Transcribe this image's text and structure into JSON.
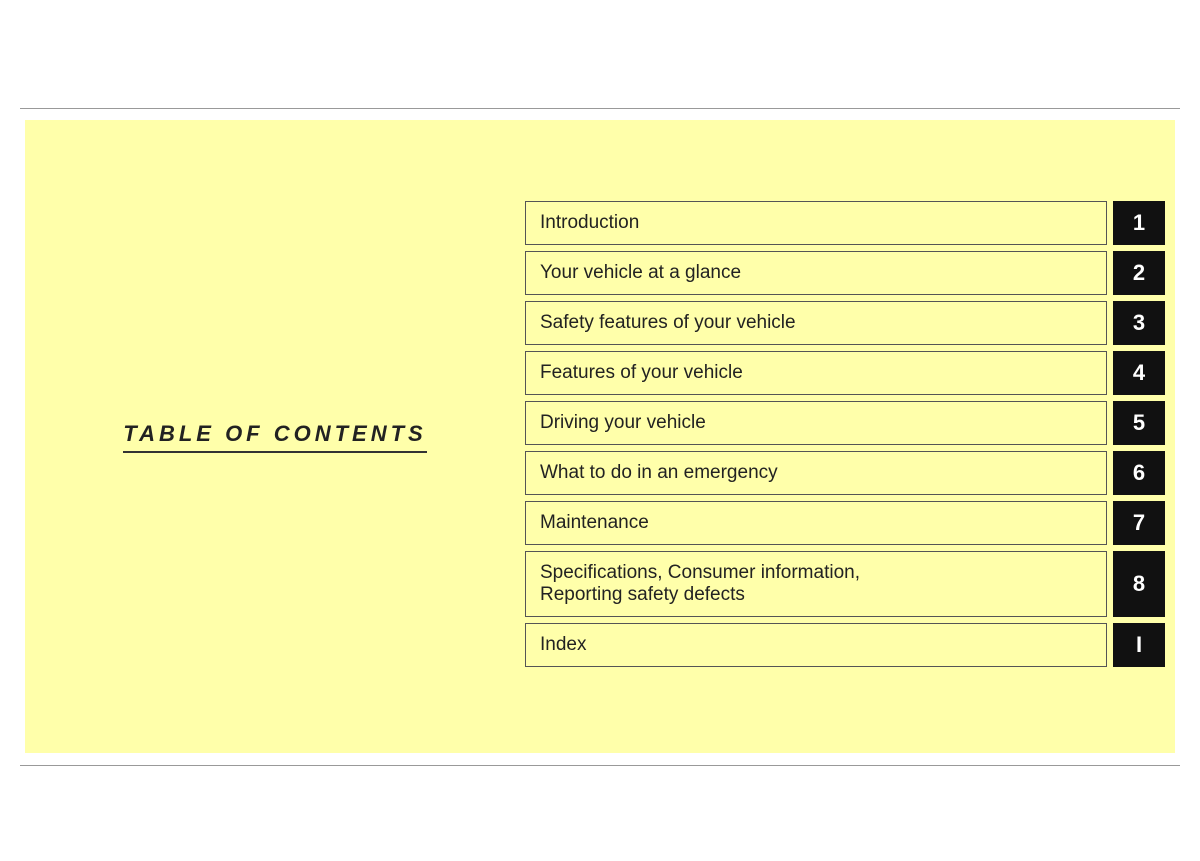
{
  "page": {
    "background_color": "#ffffff",
    "yellow_color": "#ffffaa"
  },
  "toc_title": "TABLE OF CONTENTS",
  "items": [
    {
      "label": "Introduction",
      "number": "1",
      "two_line": false
    },
    {
      "label": "Your vehicle at a glance",
      "number": "2",
      "two_line": false
    },
    {
      "label": "Safety features of your vehicle",
      "number": "3",
      "two_line": false
    },
    {
      "label": "Features of your vehicle",
      "number": "4",
      "two_line": false
    },
    {
      "label": "Driving your vehicle",
      "number": "5",
      "two_line": false
    },
    {
      "label": "What to do in an emergency",
      "number": "6",
      "two_line": false
    },
    {
      "label": "Maintenance",
      "number": "7",
      "two_line": false
    },
    {
      "label": "Specifications, Consumer information, Reporting safety defects",
      "number": "8",
      "two_line": true
    },
    {
      "label": "Index",
      "number": "I",
      "two_line": false
    }
  ]
}
